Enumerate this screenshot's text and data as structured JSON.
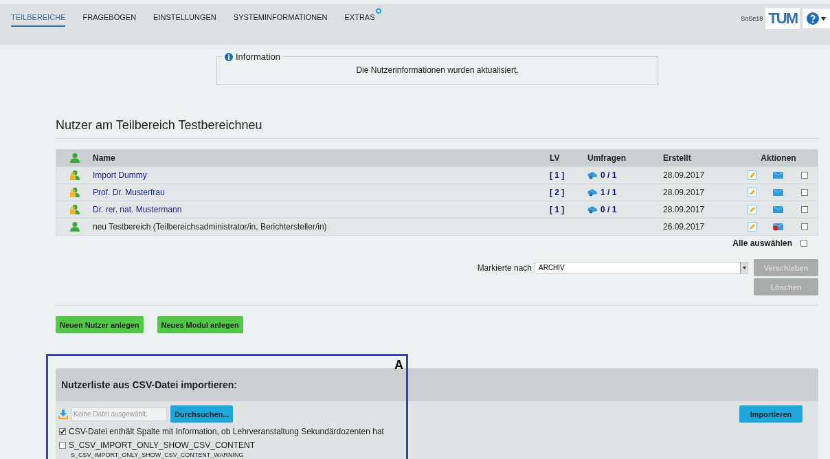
{
  "nav": {
    "tabs": [
      {
        "label": "TEILBEREICHE",
        "selected": true,
        "badge": false
      },
      {
        "label": "FRAGEBÖGEN",
        "selected": false,
        "badge": false
      },
      {
        "label": "EINSTELLUNGEN",
        "selected": false,
        "badge": false
      },
      {
        "label": "SYSTEMINFORMATIONEN",
        "selected": false,
        "badge": false
      },
      {
        "label": "EXTRAS",
        "selected": false,
        "badge": true
      }
    ],
    "semester": "SoSe18",
    "logo": "TUM"
  },
  "info": {
    "title": "Information",
    "message": "Die Nutzerinformationen wurden aktualisiert."
  },
  "heading": "Nutzer am Teilbereich Testbereichneu",
  "table": {
    "columns": [
      "Name",
      "LV",
      "Umfragen",
      "Erstellt",
      "Aktionen"
    ],
    "rows": [
      {
        "kind": "locked",
        "name": "Import Dummy",
        "link": true,
        "lv": "[ 1 ]",
        "umfragen": "0 / 1",
        "created": "28.09.2017",
        "mail_alert": false,
        "checked": false
      },
      {
        "kind": "locked",
        "name": "Prof. Dr. Musterfrau",
        "link": true,
        "lv": "[ 2 ]",
        "umfragen": "1 / 1",
        "created": "28.09.2017",
        "mail_alert": false,
        "checked": false
      },
      {
        "kind": "locked",
        "name": "Dr. rer. nat. Mustermann",
        "link": true,
        "lv": "[ 1 ]",
        "umfragen": "0 / 1",
        "created": "28.09.2017",
        "mail_alert": false,
        "checked": false
      },
      {
        "kind": "plain",
        "name": "neu Testbereich (Teilbereichsadministrator/in, Berichtersteller/in)",
        "link": false,
        "created": "26.09.2017",
        "mail_alert": true,
        "checked": false
      }
    ],
    "select_all": {
      "label": "Alle auswählen",
      "checked": false
    }
  },
  "move": {
    "label": "Markierte nach",
    "value": "ARCHIV",
    "move_button": "Verschieben",
    "delete_button": "Löschen",
    "disabled": true
  },
  "buttons": [
    "Neuen Nutzer anlegen",
    "Neues Modul anlegen"
  ],
  "csv": {
    "title": "Nutzerliste aus CSV-Datei importieren:",
    "file_placeholder": "Keine Datei ausgewählt.",
    "browse_button": "Durchsuchen...",
    "import_button": "Importieren",
    "options": [
      {
        "label": "CSV-Datei enthält Spalte mit Information, ob Lehrveranstaltung Sekundärdozenten hat",
        "checked": true
      },
      {
        "label": "S_CSV_IMPORT_ONLY_SHOW_CSV_CONTENT",
        "note": "S_CSV_IMPORT_ONLY_SHOW_CSV_CONTENT_WARNING",
        "checked": false
      }
    ]
  },
  "annotation": {
    "label": "A"
  }
}
